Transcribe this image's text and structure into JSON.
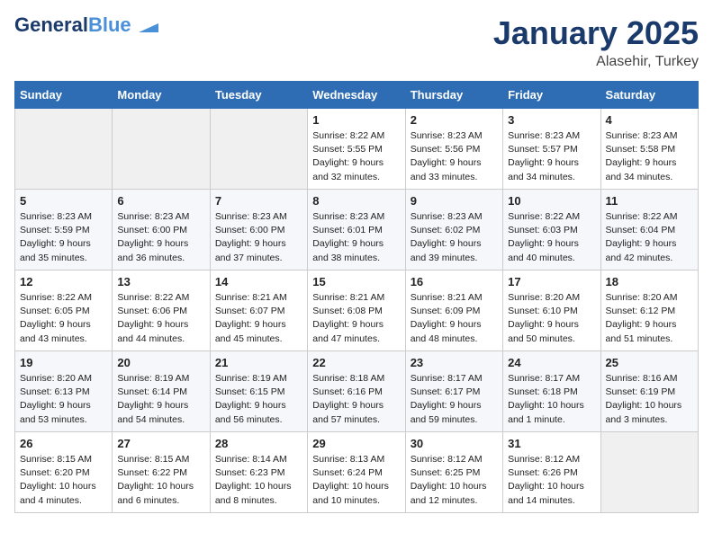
{
  "header": {
    "logo_line1": "General",
    "logo_line2": "Blue",
    "title": "January 2025",
    "subtitle": "Alasehir, Turkey"
  },
  "weekdays": [
    "Sunday",
    "Monday",
    "Tuesday",
    "Wednesday",
    "Thursday",
    "Friday",
    "Saturday"
  ],
  "weeks": [
    [
      {
        "day": "",
        "sunrise": "",
        "sunset": "",
        "daylight": ""
      },
      {
        "day": "",
        "sunrise": "",
        "sunset": "",
        "daylight": ""
      },
      {
        "day": "",
        "sunrise": "",
        "sunset": "",
        "daylight": ""
      },
      {
        "day": "1",
        "sunrise": "Sunrise: 8:22 AM",
        "sunset": "Sunset: 5:55 PM",
        "daylight": "Daylight: 9 hours and 32 minutes."
      },
      {
        "day": "2",
        "sunrise": "Sunrise: 8:23 AM",
        "sunset": "Sunset: 5:56 PM",
        "daylight": "Daylight: 9 hours and 33 minutes."
      },
      {
        "day": "3",
        "sunrise": "Sunrise: 8:23 AM",
        "sunset": "Sunset: 5:57 PM",
        "daylight": "Daylight: 9 hours and 34 minutes."
      },
      {
        "day": "4",
        "sunrise": "Sunrise: 8:23 AM",
        "sunset": "Sunset: 5:58 PM",
        "daylight": "Daylight: 9 hours and 34 minutes."
      }
    ],
    [
      {
        "day": "5",
        "sunrise": "Sunrise: 8:23 AM",
        "sunset": "Sunset: 5:59 PM",
        "daylight": "Daylight: 9 hours and 35 minutes."
      },
      {
        "day": "6",
        "sunrise": "Sunrise: 8:23 AM",
        "sunset": "Sunset: 6:00 PM",
        "daylight": "Daylight: 9 hours and 36 minutes."
      },
      {
        "day": "7",
        "sunrise": "Sunrise: 8:23 AM",
        "sunset": "Sunset: 6:00 PM",
        "daylight": "Daylight: 9 hours and 37 minutes."
      },
      {
        "day": "8",
        "sunrise": "Sunrise: 8:23 AM",
        "sunset": "Sunset: 6:01 PM",
        "daylight": "Daylight: 9 hours and 38 minutes."
      },
      {
        "day": "9",
        "sunrise": "Sunrise: 8:23 AM",
        "sunset": "Sunset: 6:02 PM",
        "daylight": "Daylight: 9 hours and 39 minutes."
      },
      {
        "day": "10",
        "sunrise": "Sunrise: 8:22 AM",
        "sunset": "Sunset: 6:03 PM",
        "daylight": "Daylight: 9 hours and 40 minutes."
      },
      {
        "day": "11",
        "sunrise": "Sunrise: 8:22 AM",
        "sunset": "Sunset: 6:04 PM",
        "daylight": "Daylight: 9 hours and 42 minutes."
      }
    ],
    [
      {
        "day": "12",
        "sunrise": "Sunrise: 8:22 AM",
        "sunset": "Sunset: 6:05 PM",
        "daylight": "Daylight: 9 hours and 43 minutes."
      },
      {
        "day": "13",
        "sunrise": "Sunrise: 8:22 AM",
        "sunset": "Sunset: 6:06 PM",
        "daylight": "Daylight: 9 hours and 44 minutes."
      },
      {
        "day": "14",
        "sunrise": "Sunrise: 8:21 AM",
        "sunset": "Sunset: 6:07 PM",
        "daylight": "Daylight: 9 hours and 45 minutes."
      },
      {
        "day": "15",
        "sunrise": "Sunrise: 8:21 AM",
        "sunset": "Sunset: 6:08 PM",
        "daylight": "Daylight: 9 hours and 47 minutes."
      },
      {
        "day": "16",
        "sunrise": "Sunrise: 8:21 AM",
        "sunset": "Sunset: 6:09 PM",
        "daylight": "Daylight: 9 hours and 48 minutes."
      },
      {
        "day": "17",
        "sunrise": "Sunrise: 8:20 AM",
        "sunset": "Sunset: 6:10 PM",
        "daylight": "Daylight: 9 hours and 50 minutes."
      },
      {
        "day": "18",
        "sunrise": "Sunrise: 8:20 AM",
        "sunset": "Sunset: 6:12 PM",
        "daylight": "Daylight: 9 hours and 51 minutes."
      }
    ],
    [
      {
        "day": "19",
        "sunrise": "Sunrise: 8:20 AM",
        "sunset": "Sunset: 6:13 PM",
        "daylight": "Daylight: 9 hours and 53 minutes."
      },
      {
        "day": "20",
        "sunrise": "Sunrise: 8:19 AM",
        "sunset": "Sunset: 6:14 PM",
        "daylight": "Daylight: 9 hours and 54 minutes."
      },
      {
        "day": "21",
        "sunrise": "Sunrise: 8:19 AM",
        "sunset": "Sunset: 6:15 PM",
        "daylight": "Daylight: 9 hours and 56 minutes."
      },
      {
        "day": "22",
        "sunrise": "Sunrise: 8:18 AM",
        "sunset": "Sunset: 6:16 PM",
        "daylight": "Daylight: 9 hours and 57 minutes."
      },
      {
        "day": "23",
        "sunrise": "Sunrise: 8:17 AM",
        "sunset": "Sunset: 6:17 PM",
        "daylight": "Daylight: 9 hours and 59 minutes."
      },
      {
        "day": "24",
        "sunrise": "Sunrise: 8:17 AM",
        "sunset": "Sunset: 6:18 PM",
        "daylight": "Daylight: 10 hours and 1 minute."
      },
      {
        "day": "25",
        "sunrise": "Sunrise: 8:16 AM",
        "sunset": "Sunset: 6:19 PM",
        "daylight": "Daylight: 10 hours and 3 minutes."
      }
    ],
    [
      {
        "day": "26",
        "sunrise": "Sunrise: 8:15 AM",
        "sunset": "Sunset: 6:20 PM",
        "daylight": "Daylight: 10 hours and 4 minutes."
      },
      {
        "day": "27",
        "sunrise": "Sunrise: 8:15 AM",
        "sunset": "Sunset: 6:22 PM",
        "daylight": "Daylight: 10 hours and 6 minutes."
      },
      {
        "day": "28",
        "sunrise": "Sunrise: 8:14 AM",
        "sunset": "Sunset: 6:23 PM",
        "daylight": "Daylight: 10 hours and 8 minutes."
      },
      {
        "day": "29",
        "sunrise": "Sunrise: 8:13 AM",
        "sunset": "Sunset: 6:24 PM",
        "daylight": "Daylight: 10 hours and 10 minutes."
      },
      {
        "day": "30",
        "sunrise": "Sunrise: 8:12 AM",
        "sunset": "Sunset: 6:25 PM",
        "daylight": "Daylight: 10 hours and 12 minutes."
      },
      {
        "day": "31",
        "sunrise": "Sunrise: 8:12 AM",
        "sunset": "Sunset: 6:26 PM",
        "daylight": "Daylight: 10 hours and 14 minutes."
      },
      {
        "day": "",
        "sunrise": "",
        "sunset": "",
        "daylight": ""
      }
    ]
  ]
}
